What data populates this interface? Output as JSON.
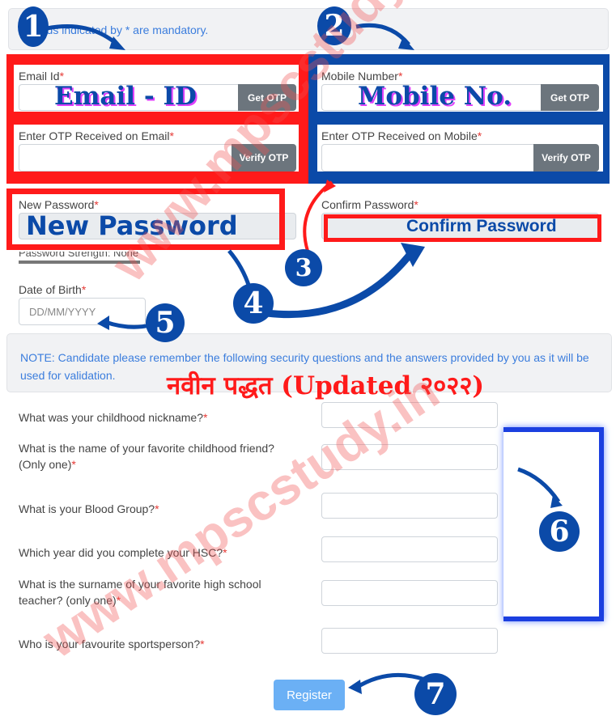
{
  "header_note": "Fields indicated by * are mandatory.",
  "email": {
    "label": "Email Id",
    "req": "*",
    "button": "Get OTP",
    "overlay": "Email - ID"
  },
  "email_otp": {
    "label": "Enter OTP Received on Email",
    "req": "*",
    "button": "Verify OTP"
  },
  "mobile": {
    "label": "Mobile Number",
    "req": "*",
    "button": "Get OTP",
    "overlay": "Mobile No."
  },
  "mobile_otp": {
    "label": "Enter OTP Received on Mobile",
    "req": "*",
    "button": "Verify OTP"
  },
  "new_password": {
    "label": "New Password",
    "req": "*",
    "overlay": "New Password",
    "strength": "Password Strength: None"
  },
  "confirm_password": {
    "label": "Confirm Password",
    "req": "*",
    "overlay": "Confirm Password"
  },
  "dob": {
    "label": "Date of Birth",
    "req": "*",
    "placeholder": "DD/MM/YYYY"
  },
  "security_note": "NOTE: Candidate please remember the following security questions and the answers provided by you as it will be used for validation.",
  "questions": [
    {
      "label": "What was your childhood nickname?",
      "req": "*"
    },
    {
      "label": "What is the name of your favorite childhood friend? (Only one)",
      "req": "*"
    },
    {
      "label": "What is your Blood Group?",
      "req": "*"
    },
    {
      "label": "Which year did you complete your HSC?",
      "req": "*"
    },
    {
      "label": "What is the surname of your favorite high school teacher? (only one)",
      "req": "*"
    },
    {
      "label": "Who is your favourite sportsperson?",
      "req": "*"
    }
  ],
  "register_label": "Register",
  "annotations": {
    "steps": [
      "1",
      "2",
      "3",
      "4",
      "5",
      "6",
      "7"
    ],
    "banner": "नवीन पद्धत (Updated २०२२)",
    "watermark": "www.mpscstudy.in"
  },
  "colors": {
    "accent_blue": "#0b4aa8",
    "annotation_red": "#ff1a1a",
    "button_gray": "#6c757d",
    "register": "#6bb0f5",
    "link": "#3b7ddd"
  }
}
